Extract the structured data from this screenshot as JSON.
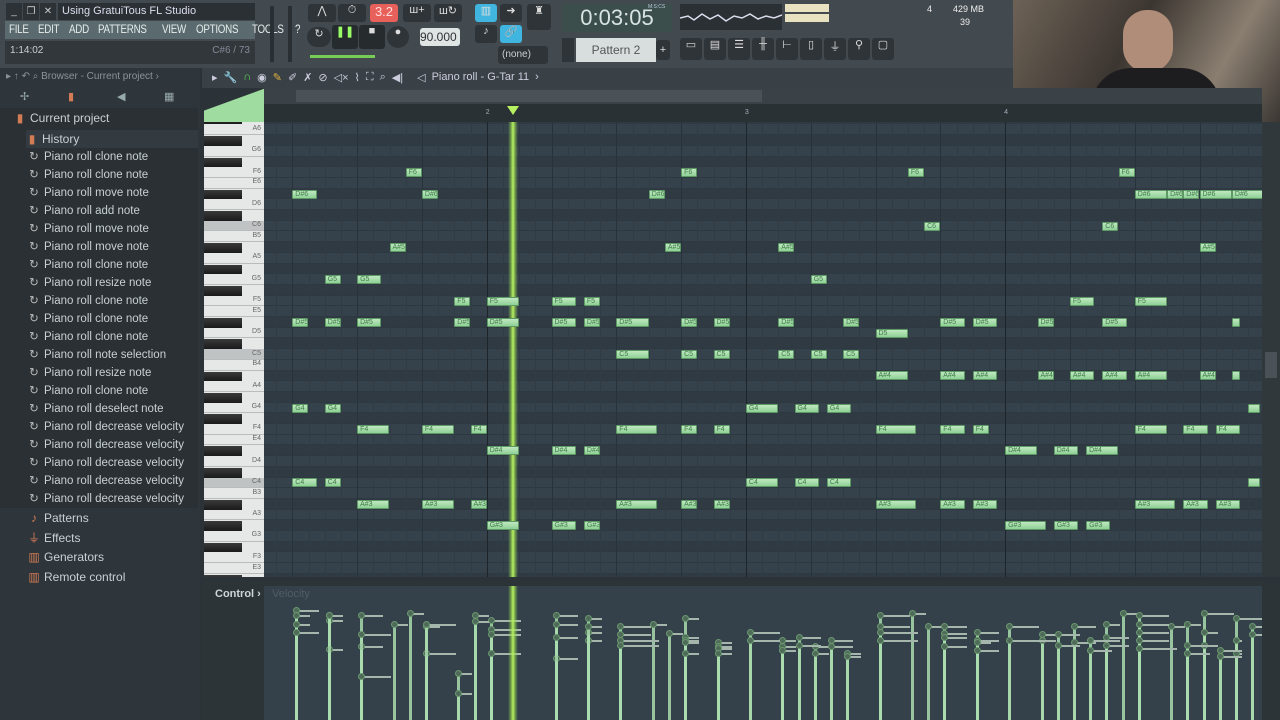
{
  "window": {
    "title": "Using GratuiTous FL Studio Template.flp"
  },
  "menu": [
    "FILE",
    "EDIT",
    "ADD",
    "PATTERNS",
    "VIEW",
    "OPTIONS",
    "TOOLS",
    "?"
  ],
  "hint": {
    "left": "1:14:02",
    "right": "C#6 / 73"
  },
  "transport": {
    "time": "0:03:05",
    "time_unit": "M:S:CS",
    "tempo": "90.000",
    "pattern": "Pattern 2",
    "snap_value": "3.2",
    "midi_input": "(none)",
    "cpu_value": "4",
    "memory": "429 MB",
    "polyphony": "39",
    "play_state": "playing"
  },
  "browser": {
    "header": "Browser - Current project",
    "root": "Current project",
    "history_label": "History",
    "history": [
      "Piano roll clone note",
      "Piano roll clone note",
      "Piano roll move note",
      "Piano roll add note",
      "Piano roll move note",
      "Piano roll move note",
      "Piano roll clone note",
      "Piano roll resize note",
      "Piano roll clone note",
      "Piano roll clone note",
      "Piano roll clone note",
      "Piano roll note selection",
      "Piano roll resize note",
      "Piano roll clone note",
      "Piano roll deselect note",
      "Piano roll decrease velocity",
      "Piano roll decrease velocity",
      "Piano roll decrease velocity",
      "Piano roll decrease velocity",
      "Piano roll decrease velocity"
    ],
    "folders": [
      {
        "label": "Patterns",
        "icon": "note-icon"
      },
      {
        "label": "Effects",
        "icon": "plugin-icon"
      },
      {
        "label": "Generators",
        "icon": "keyboard-icon"
      },
      {
        "label": "Remote control",
        "icon": "remote-icon"
      }
    ]
  },
  "piano_roll": {
    "title": "Piano roll - G-Tar 11",
    "bar_labels": [
      {
        "bar": 2,
        "label": "2"
      },
      {
        "bar": 3,
        "label": "3"
      },
      {
        "bar": 4,
        "label": "4"
      }
    ],
    "key_labels": [
      "A6",
      "G6",
      "F6",
      "E6",
      "D6",
      "C6",
      "B5",
      "A5",
      "G5",
      "F5",
      "E5",
      "D5",
      "C5",
      "B4",
      "A4",
      "G4",
      "F4",
      "E4",
      "D4",
      "C4",
      "B3",
      "A3",
      "G3",
      "F3",
      "E3"
    ],
    "playhead_step": 17.6,
    "accent": "#9fdc9f",
    "notes": [
      {
        "n": "F6",
        "s": 11,
        "l": 1,
        "v": 0.8
      },
      {
        "n": "D#6",
        "s": 4,
        "l": 1.5,
        "v": 0.82
      },
      {
        "n": "D#6",
        "s": 12,
        "l": 1,
        "v": 0.7
      },
      {
        "n": "A#5",
        "s": 10,
        "l": 1,
        "v": 0.72
      },
      {
        "n": "G5",
        "s": 6,
        "l": 1,
        "v": 0.75
      },
      {
        "n": "G5",
        "s": 8,
        "l": 1.5,
        "v": 0.78
      },
      {
        "n": "F5",
        "s": 14,
        "l": 1,
        "v": 0.35
      },
      {
        "n": "F5",
        "s": 16,
        "l": 2,
        "v": 0.75
      },
      {
        "n": "F5",
        "s": 20,
        "l": 1.5,
        "v": 0.78
      },
      {
        "n": "F5",
        "s": 22,
        "l": 1,
        "v": 0.76
      },
      {
        "n": "D#5",
        "s": 4,
        "l": 1,
        "v": 0.78
      },
      {
        "n": "D#5",
        "s": 6,
        "l": 1,
        "v": 0.78
      },
      {
        "n": "D#5",
        "s": 8,
        "l": 1.5,
        "v": 0.55
      },
      {
        "n": "D#5",
        "s": 14,
        "l": 1,
        "v": 0.2
      },
      {
        "n": "D#5",
        "s": 16,
        "l": 2,
        "v": 0.68
      },
      {
        "n": "D#5",
        "s": 20,
        "l": 1.5,
        "v": 0.72
      },
      {
        "n": "D#5",
        "s": 22,
        "l": 1,
        "v": 0.6
      },
      {
        "n": "G4",
        "s": 4,
        "l": 1,
        "v": 0.72
      },
      {
        "n": "G4",
        "s": 6,
        "l": 1,
        "v": 0.53
      },
      {
        "n": "F4",
        "s": 8,
        "l": 2,
        "v": 0.64
      },
      {
        "n": "F4",
        "s": 12,
        "l": 2,
        "v": 0.5
      },
      {
        "n": "F4",
        "s": 15,
        "l": 1,
        "v": 0.78
      },
      {
        "n": "D#4",
        "s": 16,
        "l": 2,
        "v": 0.64
      },
      {
        "n": "D#4",
        "s": 20,
        "l": 1.5,
        "v": 0.46
      },
      {
        "n": "D#4",
        "s": 22,
        "l": 1,
        "v": 0.66
      },
      {
        "n": "C4",
        "s": 4,
        "l": 1.5,
        "v": 0.66
      },
      {
        "n": "C4",
        "s": 6,
        "l": 1,
        "v": 0.78
      },
      {
        "n": "A#3",
        "s": 8,
        "l": 2,
        "v": 0.33
      },
      {
        "n": "A#3",
        "s": 12,
        "l": 2,
        "v": 0.72
      },
      {
        "n": "A#3",
        "s": 15,
        "l": 1,
        "v": 0.74
      },
      {
        "n": "G#3",
        "s": 16,
        "l": 2,
        "v": 0.5
      },
      {
        "n": "G#3",
        "s": 20,
        "l": 1.5,
        "v": 0.62
      },
      {
        "n": "G#3",
        "s": 22,
        "l": 1,
        "v": 0.7
      },
      {
        "n": "F6",
        "s": 28,
        "l": 1,
        "v": 0.76
      },
      {
        "n": "F6",
        "s": 42,
        "l": 1,
        "v": 0.8
      },
      {
        "n": "D#6",
        "s": 26,
        "l": 1,
        "v": 0.72
      },
      {
        "n": "C6",
        "s": 43,
        "l": 1,
        "v": 0.7
      },
      {
        "n": "A#5",
        "s": 27,
        "l": 1,
        "v": 0.65
      },
      {
        "n": "A#5",
        "s": 34,
        "l": 1,
        "v": 0.6
      },
      {
        "n": "G5",
        "s": 36,
        "l": 1,
        "v": 0.55
      },
      {
        "n": "D#5",
        "s": 24,
        "l": 2,
        "v": 0.7
      },
      {
        "n": "D#5",
        "s": 28,
        "l": 1,
        "v": 0.62
      },
      {
        "n": "D#5",
        "s": 30,
        "l": 1,
        "v": 0.58
      },
      {
        "n": "D#5",
        "s": 34,
        "l": 1,
        "v": 0.55
      },
      {
        "n": "D#5",
        "s": 38,
        "l": 1,
        "v": 0.5
      },
      {
        "n": "D#5",
        "s": 44,
        "l": 1.5,
        "v": 0.7
      },
      {
        "n": "D#5",
        "s": 46,
        "l": 1.5,
        "v": 0.66
      },
      {
        "n": "D5",
        "s": 40,
        "l": 2,
        "v": 0.78
      },
      {
        "n": "C5",
        "s": 24,
        "l": 2,
        "v": 0.64
      },
      {
        "n": "C5",
        "s": 28,
        "l": 1,
        "v": 0.6
      },
      {
        "n": "C5",
        "s": 30,
        "l": 1,
        "v": 0.55
      },
      {
        "n": "C5",
        "s": 34,
        "l": 1,
        "v": 0.52
      },
      {
        "n": "C5",
        "s": 36,
        "l": 1,
        "v": 0.5
      },
      {
        "n": "C5",
        "s": 38,
        "l": 1,
        "v": 0.48
      },
      {
        "n": "A#4",
        "s": 40,
        "l": 2,
        "v": 0.7
      },
      {
        "n": "A#4",
        "s": 44,
        "l": 1.5,
        "v": 0.65
      },
      {
        "n": "A#4",
        "s": 46,
        "l": 1.5,
        "v": 0.6
      },
      {
        "n": "G4",
        "s": 32,
        "l": 2,
        "v": 0.66
      },
      {
        "n": "G4",
        "s": 35,
        "l": 1.5,
        "v": 0.62
      },
      {
        "n": "G4",
        "s": 37,
        "l": 1.5,
        "v": 0.6
      },
      {
        "n": "F4",
        "s": 24,
        "l": 2.5,
        "v": 0.6
      },
      {
        "n": "F4",
        "s": 28,
        "l": 1,
        "v": 0.58
      },
      {
        "n": "F4",
        "s": 30,
        "l": 1,
        "v": 0.54
      },
      {
        "n": "F4",
        "s": 40,
        "l": 2.5,
        "v": 0.66
      },
      {
        "n": "F4",
        "s": 44,
        "l": 1.5,
        "v": 0.62
      },
      {
        "n": "F4",
        "s": 46,
        "l": 1,
        "v": 0.58
      },
      {
        "n": "C4",
        "s": 32,
        "l": 2,
        "v": 0.6
      },
      {
        "n": "C4",
        "s": 35,
        "l": 1.5,
        "v": 0.56
      },
      {
        "n": "C4",
        "s": 37,
        "l": 1.5,
        "v": 0.55
      },
      {
        "n": "A#3",
        "s": 24,
        "l": 2.5,
        "v": 0.56
      },
      {
        "n": "A#3",
        "s": 28,
        "l": 1,
        "v": 0.5
      },
      {
        "n": "A#3",
        "s": 30,
        "l": 1,
        "v": 0.5
      },
      {
        "n": "A#3",
        "s": 40,
        "l": 2.5,
        "v": 0.6
      },
      {
        "n": "A#3",
        "s": 44,
        "l": 1.5,
        "v": 0.55
      },
      {
        "n": "A#3",
        "s": 46,
        "l": 1.5,
        "v": 0.52
      },
      {
        "n": "F6",
        "s": 55,
        "l": 1,
        "v": 0.8
      },
      {
        "n": "D#6",
        "s": 56,
        "l": 2,
        "v": 0.78
      },
      {
        "n": "D#6",
        "s": 58,
        "l": 1,
        "v": 0.7
      },
      {
        "n": "D#6",
        "s": 59,
        "l": 1,
        "v": 0.72
      },
      {
        "n": "D#6",
        "s": 60,
        "l": 2,
        "v": 0.8
      },
      {
        "n": "D#6",
        "s": 62,
        "l": 2,
        "v": 0.76
      },
      {
        "n": "C6",
        "s": 54,
        "l": 1,
        "v": 0.72
      },
      {
        "n": "A#5",
        "s": 60,
        "l": 1,
        "v": 0.66
      },
      {
        "n": "F5",
        "s": 52,
        "l": 1.5,
        "v": 0.7
      },
      {
        "n": "F5",
        "s": 56,
        "l": 2,
        "v": 0.72
      },
      {
        "n": "D#5",
        "s": 50,
        "l": 1,
        "v": 0.64
      },
      {
        "n": "D#5",
        "s": 54,
        "l": 1.5,
        "v": 0.62
      },
      {
        "n": "D#5",
        "s": 62,
        "l": 0.5,
        "v": 0.6
      },
      {
        "n": "A#4",
        "s": 50,
        "l": 1,
        "v": 0.6
      },
      {
        "n": "A#4",
        "s": 52,
        "l": 1.5,
        "v": 0.58
      },
      {
        "n": "A#4",
        "s": 54,
        "l": 1.5,
        "v": 0.56
      },
      {
        "n": "A#4",
        "s": 56,
        "l": 2,
        "v": 0.66
      },
      {
        "n": "A#4",
        "s": 60,
        "l": 1,
        "v": 0.56
      },
      {
        "n": "A#4",
        "s": 62,
        "l": 0.5,
        "v": 0.5
      },
      {
        "n": "G4",
        "s": 63,
        "l": 0.75,
        "v": 0.7
      },
      {
        "n": "F4",
        "s": 56,
        "l": 2,
        "v": 0.6
      },
      {
        "n": "F4",
        "s": 59,
        "l": 1.5,
        "v": 0.56
      },
      {
        "n": "F4",
        "s": 61,
        "l": 1.5,
        "v": 0.52
      },
      {
        "n": "D#4",
        "s": 48,
        "l": 2,
        "v": 0.7
      },
      {
        "n": "D#4",
        "s": 51,
        "l": 1.5,
        "v": 0.64
      },
      {
        "n": "D#4",
        "s": 53,
        "l": 2,
        "v": 0.6
      },
      {
        "n": "C4",
        "s": 63,
        "l": 0.75,
        "v": 0.64
      },
      {
        "n": "A#3",
        "s": 56,
        "l": 2.5,
        "v": 0.54
      },
      {
        "n": "A#3",
        "s": 59,
        "l": 1.5,
        "v": 0.5
      },
      {
        "n": "A#3",
        "s": 61,
        "l": 1.5,
        "v": 0.48
      },
      {
        "n": "G#3",
        "s": 48,
        "l": 2.5,
        "v": 0.6
      },
      {
        "n": "G#3",
        "s": 51,
        "l": 1.5,
        "v": 0.56
      },
      {
        "n": "G#3",
        "s": 53,
        "l": 1.5,
        "v": 0.52
      }
    ]
  },
  "control": {
    "label": "Control",
    "lane": "Velocity"
  }
}
